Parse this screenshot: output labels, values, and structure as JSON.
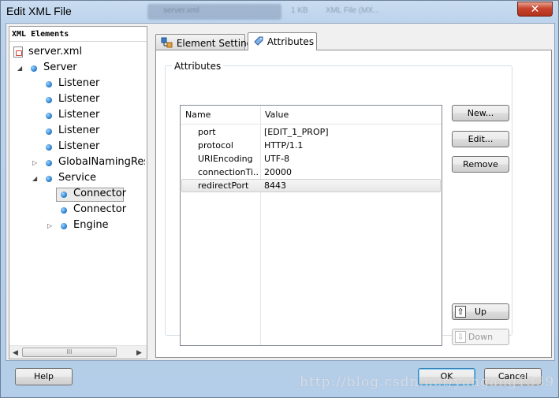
{
  "window": {
    "title": "Edit XML File",
    "close_glyph": "✕"
  },
  "background_tabs": [
    "server.xml",
    "1 KB",
    "XML File (MX..."
  ],
  "tree": {
    "header": "XML Elements",
    "items": [
      {
        "label": "server.xml",
        "icon": "xml-file-icon",
        "expander": ""
      },
      {
        "label": "Server",
        "icon": "element-bullet-icon",
        "expander": "◢"
      },
      {
        "label": "Listener",
        "icon": "element-bullet-icon",
        "expander": ""
      },
      {
        "label": "Listener",
        "icon": "element-bullet-icon",
        "expander": ""
      },
      {
        "label": "Listener",
        "icon": "element-bullet-icon",
        "expander": ""
      },
      {
        "label": "Listener",
        "icon": "element-bullet-icon",
        "expander": ""
      },
      {
        "label": "Listener",
        "icon": "element-bullet-icon",
        "expander": ""
      },
      {
        "label": "GlobalNamingResc",
        "icon": "element-bullet-icon",
        "expander": "▷"
      },
      {
        "label": "Service",
        "icon": "element-bullet-icon",
        "expander": "◢"
      },
      {
        "label": "Connector",
        "icon": "element-bullet-icon",
        "expander": "",
        "selected": true
      },
      {
        "label": "Connector",
        "icon": "element-bullet-icon",
        "expander": ""
      },
      {
        "label": "Engine",
        "icon": "element-bullet-icon",
        "expander": "▷"
      }
    ],
    "scroll": {
      "left": "◀",
      "right": "▶",
      "grip": "III"
    }
  },
  "tabs": [
    {
      "label": "Element Settings",
      "icon": "element-settings-icon",
      "active": false
    },
    {
      "label": "Attributes",
      "icon": "tag-icon",
      "active": true
    }
  ],
  "attributes": {
    "group_label": "Attributes",
    "columns": [
      "Name",
      "Value"
    ],
    "rows": [
      {
        "name": "port",
        "value": "[EDIT_1_PROP]"
      },
      {
        "name": "protocol",
        "value": "HTTP/1.1"
      },
      {
        "name": "URIEncoding",
        "value": "UTF-8"
      },
      {
        "name": "connectionTi...",
        "value": "20000"
      },
      {
        "name": "redirectPort",
        "value": "8443",
        "highlighted": true
      }
    ]
  },
  "side_buttons": {
    "new": "New...",
    "edit": "Edit...",
    "remove": "Remove",
    "up": "Up",
    "up_glyph": "⇧",
    "down": "Down",
    "down_glyph": "⇩"
  },
  "footer": {
    "help": "Help",
    "ok": "OK",
    "cancel": "Cancel"
  },
  "watermark": "http://blog.csdn.net/yangang1339"
}
